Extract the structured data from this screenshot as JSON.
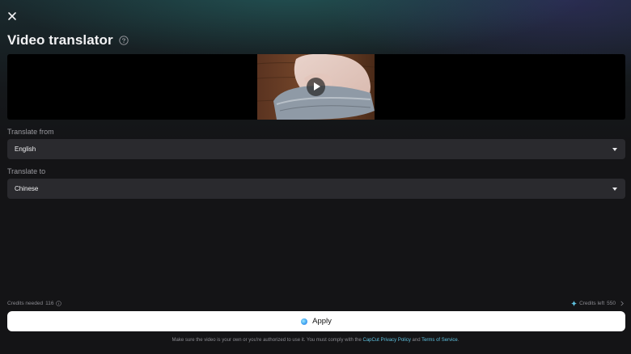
{
  "header": {
    "title": "Video translator",
    "close_icon": "close-icon",
    "help_icon": "help-circle-icon"
  },
  "preview": {
    "play_icon": "play-icon"
  },
  "translate_from": {
    "label": "Translate from",
    "value": "English"
  },
  "translate_to": {
    "label": "Translate to",
    "value": "Chinese"
  },
  "footer": {
    "credits_needed_label": "Credits needed",
    "credits_needed_value": "116",
    "credits_left_label": "Credits left",
    "credits_left_value": "550",
    "apply_label": "Apply",
    "disclaimer_text": "Make sure the video is your own or you're authorized to use it. You must comply with the",
    "privacy_link": "CapCut Privacy Policy",
    "and_text": "and",
    "terms_link": "Terms of Service",
    "period": "."
  },
  "colors": {
    "background": "#141416",
    "field_background": "#2a2a2e",
    "accent_link": "#5fc2e0",
    "apply_button": "#ffffff"
  }
}
